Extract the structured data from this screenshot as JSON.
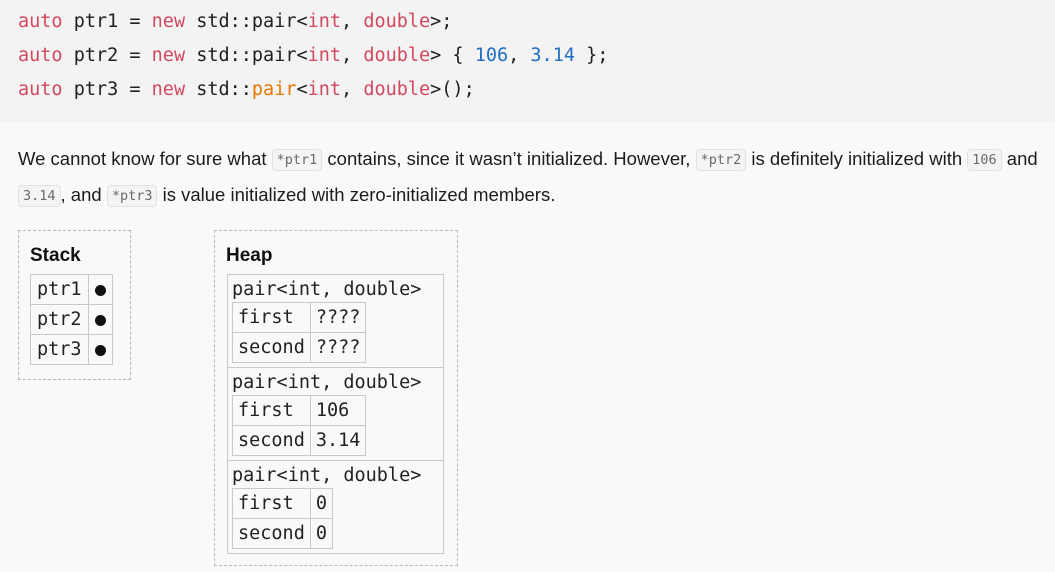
{
  "code": {
    "lines": [
      [
        {
          "t": "auto",
          "c": "kw"
        },
        {
          "t": " ptr1 = ",
          "c": "plain"
        },
        {
          "t": "new",
          "c": "kw"
        },
        {
          "t": " std::pair<",
          "c": "plain"
        },
        {
          "t": "int",
          "c": "ty"
        },
        {
          "t": ", ",
          "c": "plain"
        },
        {
          "t": "double",
          "c": "ty"
        },
        {
          "t": ">;",
          "c": "plain"
        }
      ],
      [
        {
          "t": "auto",
          "c": "kw"
        },
        {
          "t": " ptr2 = ",
          "c": "plain"
        },
        {
          "t": "new",
          "c": "kw"
        },
        {
          "t": " std::pair<",
          "c": "plain"
        },
        {
          "t": "int",
          "c": "ty"
        },
        {
          "t": ", ",
          "c": "plain"
        },
        {
          "t": "double",
          "c": "ty"
        },
        {
          "t": "> { ",
          "c": "plain"
        },
        {
          "t": "106",
          "c": "num"
        },
        {
          "t": ", ",
          "c": "plain"
        },
        {
          "t": "3.14",
          "c": "num"
        },
        {
          "t": " };",
          "c": "plain"
        }
      ],
      [
        {
          "t": "auto",
          "c": "kw"
        },
        {
          "t": " ptr3 = ",
          "c": "plain"
        },
        {
          "t": "new",
          "c": "kw"
        },
        {
          "t": " std::",
          "c": "plain"
        },
        {
          "t": "pair",
          "c": "fn"
        },
        {
          "t": "<",
          "c": "plain"
        },
        {
          "t": "int",
          "c": "ty"
        },
        {
          "t": ", ",
          "c": "plain"
        },
        {
          "t": "double",
          "c": "ty"
        },
        {
          "t": ">();",
          "c": "plain"
        }
      ]
    ]
  },
  "paragraph": {
    "t1": "We cannot know for sure what ",
    "c1": "*ptr1",
    "t2": " contains, since it wasn’t initialized. However, ",
    "c2": "*ptr2",
    "t3": " is definitely initialized with ",
    "c3": "106",
    "t4": " and ",
    "c4": "3.14",
    "t5": ", and ",
    "c5": "*ptr3",
    "t6": " is value initialized with zero-initialized members."
  },
  "stack": {
    "title": "Stack",
    "rows": [
      "ptr1",
      "ptr2",
      "ptr3"
    ]
  },
  "heap": {
    "title": "Heap",
    "blocks": [
      {
        "type": "pair<int, double>",
        "first_label": "first",
        "first": "????",
        "second_label": "second",
        "second": "????"
      },
      {
        "type": "pair<int, double>",
        "first_label": "first",
        "first": "106",
        "second_label": "second",
        "second": "3.14"
      },
      {
        "type": "pair<int, double>",
        "first_label": "first",
        "first": "0",
        "second_label": "second",
        "second": "0"
      }
    ]
  }
}
